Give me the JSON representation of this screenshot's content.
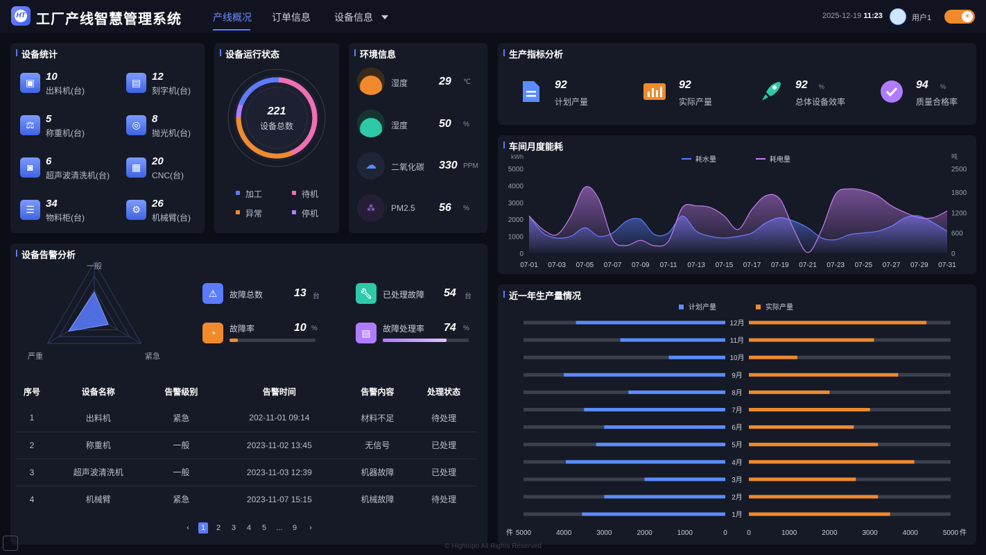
{
  "header": {
    "logo_text": "HT",
    "title": "工厂产线智慧管理系统",
    "nav": [
      {
        "label": "产线概况",
        "active": true
      },
      {
        "label": "订单信息",
        "active": false
      },
      {
        "label": "设备信息",
        "active": false
      }
    ],
    "date": "2025-12-19",
    "time": "11:23",
    "user": "用户1",
    "theme_toggle": "sun-icon"
  },
  "device_stats": {
    "title": "设备统计",
    "items": [
      {
        "count": "10",
        "label": "出料机(台)",
        "icon": "discharger-icon"
      },
      {
        "count": "12",
        "label": "刻字机(台)",
        "icon": "engraver-icon"
      },
      {
        "count": "5",
        "label": "称重机(台)",
        "icon": "scale-icon"
      },
      {
        "count": "8",
        "label": "抛光机(台)",
        "icon": "polisher-icon"
      },
      {
        "count": "6",
        "label": "超声波清洗机(台)",
        "icon": "cleaner-icon"
      },
      {
        "count": "20",
        "label": "CNC(台)",
        "icon": "cnc-icon"
      },
      {
        "count": "34",
        "label": "物料柜(台)",
        "icon": "cabinet-icon"
      },
      {
        "count": "26",
        "label": "机械臂(台)",
        "icon": "robot-arm-icon"
      }
    ]
  },
  "run_status": {
    "title": "设备运行状态",
    "total": "221",
    "total_label": "设备总数",
    "legend": [
      {
        "label": "加工",
        "color": "#5b7cff"
      },
      {
        "label": "待机",
        "color": "#f06fb3"
      },
      {
        "label": "异常",
        "color": "#f08a2c"
      },
      {
        "label": "停机",
        "color": "#b07cff"
      }
    ]
  },
  "environment": {
    "title": "环境信息",
    "items": [
      {
        "label": "湿度",
        "value": "29",
        "unit": "℃",
        "color": "#f08a2c"
      },
      {
        "label": "湿度",
        "value": "50",
        "unit": "%",
        "color": "#2ec9a8"
      },
      {
        "label": "二氧化碳",
        "value": "330",
        "unit": "PPM",
        "color": "#5b8cff"
      },
      {
        "label": "PM2.5",
        "value": "56",
        "unit": "%",
        "color": "#b07cff"
      }
    ]
  },
  "production_kpi": {
    "title": "生产指标分析",
    "items": [
      {
        "value": "92",
        "unit": "",
        "label": "计划产量",
        "icon": "document-icon",
        "color": "#5b8cff"
      },
      {
        "value": "92",
        "unit": "",
        "label": "实际产量",
        "icon": "bar-chart-icon",
        "color": "#f08a2c"
      },
      {
        "value": "92",
        "unit": "%",
        "label": "总体设备效率",
        "icon": "rocket-icon",
        "color": "#2ec9a8"
      },
      {
        "value": "94",
        "unit": "%",
        "label": "质量合格率",
        "icon": "check-icon",
        "color": "#b07cff"
      }
    ]
  },
  "alarm": {
    "title": "设备告警分析",
    "radar_labels": [
      "一般",
      "严重",
      "紧急"
    ],
    "radar_values": [
      0.45,
      0.55,
      0.3
    ],
    "stats": [
      {
        "label": "故障总数",
        "value": "13",
        "unit": "台",
        "icon": "warning-icon",
        "color": "#5b7cff"
      },
      {
        "label": "已处理故障",
        "value": "54",
        "unit": "台",
        "icon": "wrench-icon",
        "color": "#2ec9a8"
      },
      {
        "label": "故障率",
        "value": "10",
        "unit": "%",
        "icon": "pie-icon",
        "color": "#f08a2c",
        "progress": 0.1
      },
      {
        "label": "故障处理率",
        "value": "74",
        "unit": "%",
        "icon": "report-icon",
        "color": "#b07cff",
        "progress": 0.74
      }
    ],
    "table": {
      "headers": [
        "序号",
        "设备名称",
        "告警级别",
        "告警时间",
        "告警内容",
        "处理状态"
      ],
      "rows": [
        [
          "1",
          "出料机",
          "紧急",
          "202-11-01 09:14",
          "材料不足",
          "待处理"
        ],
        [
          "2",
          "称重机",
          "一般",
          "2023-11-02 13:45",
          "无信号",
          "已处理"
        ],
        [
          "3",
          "超声波清洗机",
          "一般",
          "2023-11-03 12:39",
          "机器故障",
          "已处理"
        ],
        [
          "4",
          "机械臂",
          "紧急",
          "2023-11-07 15:15",
          "机械故障",
          "待处理"
        ]
      ]
    },
    "pagination": {
      "prev": "‹",
      "pages": [
        "1",
        "2",
        "3",
        "4",
        "5",
        "...",
        "9"
      ],
      "active": "1",
      "next": "›"
    }
  },
  "energy_chart": {
    "title": "车间月度能耗",
    "chart_data": {
      "type": "area",
      "title": "车间月度能耗",
      "x": [
        "07-01",
        "07-02",
        "07-03",
        "07-04",
        "07-05",
        "07-06",
        "07-07",
        "07-08",
        "07-09",
        "07-10",
        "07-11",
        "07-12",
        "07-13",
        "07-14",
        "07-15",
        "07-16",
        "07-17",
        "07-18",
        "07-19",
        "07-20",
        "07-21",
        "07-22",
        "07-23",
        "07-24",
        "07-25",
        "07-26",
        "07-27",
        "07-28",
        "07-29",
        "07-30",
        "07-31"
      ],
      "x_tick_labels": [
        "07-01",
        "07-03",
        "07-05",
        "07-07",
        "07-09",
        "07-11",
        "07-13",
        "07-15",
        "07-17",
        "07-19",
        "07-21",
        "07-23",
        "07-25",
        "07-27",
        "07-29",
        "07-31"
      ],
      "left_axis": {
        "label": "kWh",
        "ylim": [
          0,
          5000
        ],
        "ticks": [
          "0",
          "1000",
          "2000",
          "3000",
          "4000",
          "5000"
        ]
      },
      "right_axis": {
        "label": "吨",
        "ylim": [
          0,
          2500
        ],
        "ticks": [
          "0",
          "600",
          "1200",
          "1800",
          "2500"
        ]
      },
      "series": [
        {
          "name": "耗水量",
          "axis": "left",
          "color": "#5b7cff",
          "values": [
            2200,
            1200,
            900,
            1000,
            1500,
            1000,
            1200,
            1900,
            2000,
            1100,
            1200,
            2200,
            1300,
            1000,
            900,
            1000,
            1200,
            1800,
            2100,
            1900,
            1500,
            900,
            800,
            1100,
            1200,
            1300,
            1600,
            2100,
            2200,
            1800,
            1300
          ]
        },
        {
          "name": "耗电量",
          "axis": "right",
          "color": "#c47cf0",
          "values": [
            1100,
            700,
            550,
            1100,
            1950,
            1600,
            400,
            230,
            380,
            220,
            350,
            1350,
            1400,
            1350,
            1100,
            700,
            1300,
            1700,
            1600,
            700,
            20,
            700,
            1750,
            1900,
            1850,
            1700,
            1400,
            1200,
            1050,
            1050,
            1250
          ]
        }
      ],
      "legend_position": "top"
    }
  },
  "yearly_chart": {
    "title": "近一年生产量情况",
    "chart_data": {
      "type": "bar",
      "orientation": "horizontal-butterfly",
      "categories": [
        "12月",
        "11月",
        "10月",
        "9月",
        "8月",
        "7月",
        "6月",
        "5月",
        "4月",
        "3月",
        "2月",
        "1月"
      ],
      "series": [
        {
          "name": "计划产量",
          "color": "#5b8cff",
          "values": [
            3700,
            2600,
            1400,
            4000,
            2400,
            3500,
            3000,
            3200,
            3950,
            2000,
            3000,
            3550
          ]
        },
        {
          "name": "实际产量",
          "color": "#f08a2c",
          "values": [
            4400,
            3100,
            1200,
            3700,
            2000,
            3000,
            2600,
            3200,
            4100,
            2650,
            3200,
            3500
          ]
        }
      ],
      "axis_ticks_left": [
        "5000",
        "4000",
        "3000",
        "2000",
        "1000",
        "0"
      ],
      "axis_ticks_right": [
        "0",
        "1000",
        "2000",
        "3000",
        "4000",
        "5000"
      ],
      "unit": "件",
      "xlim": [
        0,
        5000
      ],
      "legend_position": "top"
    }
  },
  "footer": "© Hightopo All Rights Reserved"
}
